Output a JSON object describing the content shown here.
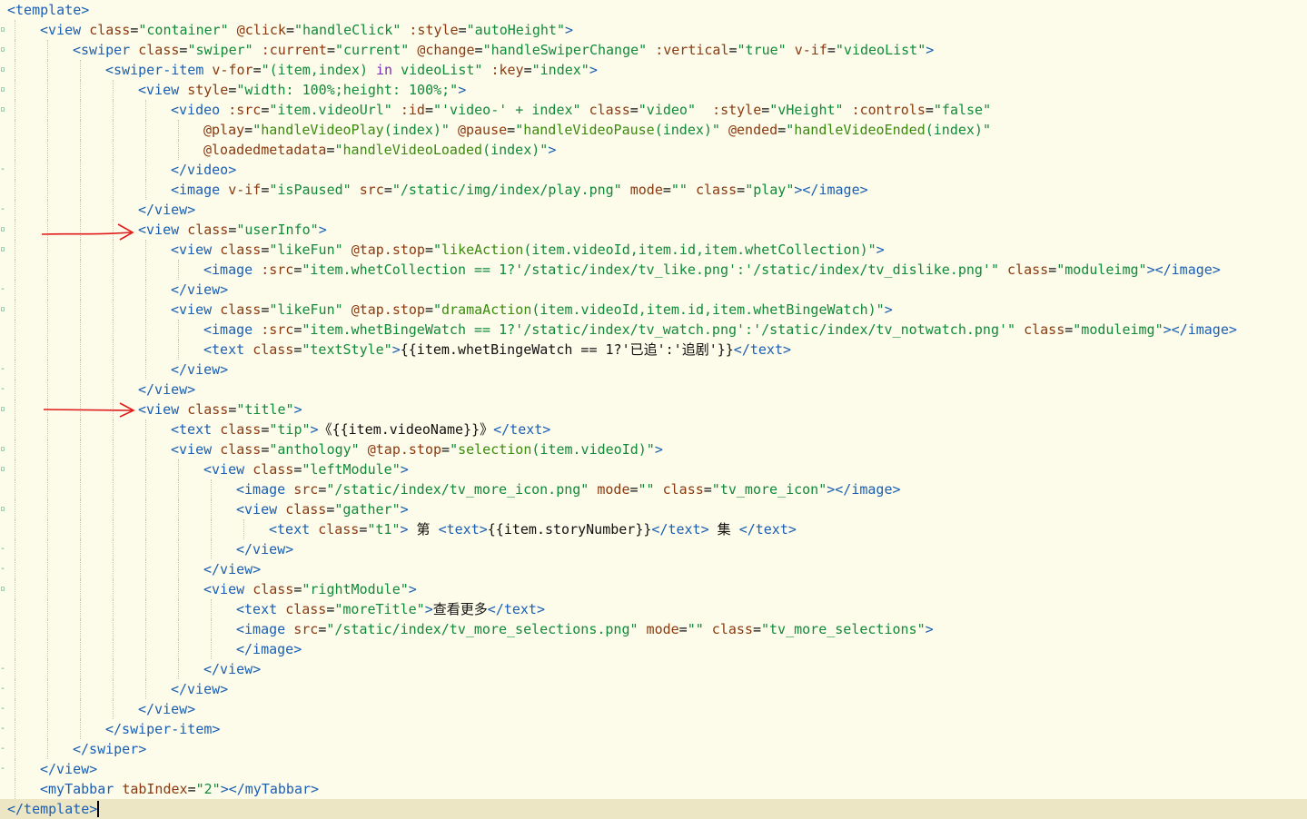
{
  "colors": {
    "background": "#fdfbe9",
    "current_line": "#ece6c4",
    "tag": "#1a5fb4",
    "attribute": "#8a3a10",
    "string": "#118a3a",
    "function": "#3b8a10",
    "keyword": "#7a2fb0",
    "annotation_arrow": "#e01b1b"
  },
  "annotations": [
    "red-arrow-userinfo",
    "red-arrow-title"
  ],
  "lines": [
    {
      "indent": 0,
      "fold": "",
      "current": false,
      "tokens": [
        [
          "tag",
          "<template>"
        ]
      ]
    },
    {
      "indent": 1,
      "fold": "▫",
      "current": false,
      "tokens": [
        [
          "tag",
          "<view "
        ],
        [
          "attr",
          "class"
        ],
        [
          "txt",
          "="
        ],
        [
          "str",
          "\"container\""
        ],
        [
          "txt",
          " "
        ],
        [
          "attr",
          "@click"
        ],
        [
          "txt",
          "="
        ],
        [
          "str",
          "\"handleClick\""
        ],
        [
          "txt",
          " "
        ],
        [
          "attr",
          ":style"
        ],
        [
          "txt",
          "="
        ],
        [
          "str",
          "\"autoHeight\""
        ],
        [
          "tag",
          ">"
        ]
      ]
    },
    {
      "indent": 2,
      "fold": "▫",
      "current": false,
      "tokens": [
        [
          "tag",
          "<swiper "
        ],
        [
          "attr",
          "class"
        ],
        [
          "txt",
          "="
        ],
        [
          "str",
          "\"swiper\""
        ],
        [
          "txt",
          " "
        ],
        [
          "attr",
          ":current"
        ],
        [
          "txt",
          "="
        ],
        [
          "str",
          "\"current\""
        ],
        [
          "txt",
          " "
        ],
        [
          "attr",
          "@change"
        ],
        [
          "txt",
          "="
        ],
        [
          "str",
          "\"handleSwiperChange\""
        ],
        [
          "txt",
          " "
        ],
        [
          "attr",
          ":vertical"
        ],
        [
          "txt",
          "="
        ],
        [
          "str",
          "\"true\""
        ],
        [
          "txt",
          " "
        ],
        [
          "attr",
          "v-if"
        ],
        [
          "txt",
          "="
        ],
        [
          "str",
          "\"videoList\""
        ],
        [
          "tag",
          ">"
        ]
      ]
    },
    {
      "indent": 3,
      "fold": "▫",
      "current": false,
      "tokens": [
        [
          "tag",
          "<swiper-item "
        ],
        [
          "attr",
          "v-for"
        ],
        [
          "txt",
          "="
        ],
        [
          "str",
          "\"(item,index) "
        ],
        [
          "kw",
          "in"
        ],
        [
          "str",
          " videoList\""
        ],
        [
          "txt",
          " "
        ],
        [
          "attr",
          ":key"
        ],
        [
          "txt",
          "="
        ],
        [
          "str",
          "\"index\""
        ],
        [
          "tag",
          ">"
        ]
      ]
    },
    {
      "indent": 4,
      "fold": "▫",
      "current": false,
      "tokens": [
        [
          "tag",
          "<view "
        ],
        [
          "attr",
          "style"
        ],
        [
          "txt",
          "="
        ],
        [
          "str",
          "\"width: 100%;height: 100%;\""
        ],
        [
          "tag",
          ">"
        ]
      ]
    },
    {
      "indent": 5,
      "fold": "▫",
      "current": false,
      "tokens": [
        [
          "tag",
          "<video "
        ],
        [
          "attr",
          ":src"
        ],
        [
          "txt",
          "="
        ],
        [
          "str",
          "\"item.videoUrl\""
        ],
        [
          "txt",
          " "
        ],
        [
          "attr",
          ":id"
        ],
        [
          "txt",
          "="
        ],
        [
          "str",
          "\"'video-' + index\""
        ],
        [
          "txt",
          " "
        ],
        [
          "attr",
          "class"
        ],
        [
          "txt",
          "="
        ],
        [
          "str",
          "\"video\""
        ],
        [
          "txt",
          "  "
        ],
        [
          "attr",
          ":style"
        ],
        [
          "txt",
          "="
        ],
        [
          "str",
          "\"vHeight\""
        ],
        [
          "txt",
          " "
        ],
        [
          "attr",
          ":controls"
        ],
        [
          "txt",
          "="
        ],
        [
          "str",
          "\"false\""
        ]
      ]
    },
    {
      "indent": 6,
      "fold": "",
      "current": false,
      "tokens": [
        [
          "attr",
          "@play"
        ],
        [
          "txt",
          "="
        ],
        [
          "str",
          "\""
        ],
        [
          "fn",
          "handleVideoPlay"
        ],
        [
          "str",
          "(index)\""
        ],
        [
          "txt",
          " "
        ],
        [
          "attr",
          "@pause"
        ],
        [
          "txt",
          "="
        ],
        [
          "str",
          "\""
        ],
        [
          "fn",
          "handleVideoPause"
        ],
        [
          "str",
          "(index)\""
        ],
        [
          "txt",
          " "
        ],
        [
          "attr",
          "@ended"
        ],
        [
          "txt",
          "="
        ],
        [
          "str",
          "\""
        ],
        [
          "fn",
          "handleVideoEnded"
        ],
        [
          "str",
          "(index)\""
        ]
      ]
    },
    {
      "indent": 6,
      "fold": "",
      "current": false,
      "tokens": [
        [
          "attr",
          "@loadedmetadata"
        ],
        [
          "txt",
          "="
        ],
        [
          "str",
          "\""
        ],
        [
          "fn",
          "handleVideoLoaded"
        ],
        [
          "str",
          "(index)\""
        ],
        [
          "tag",
          ">"
        ]
      ]
    },
    {
      "indent": 5,
      "fold": "-",
      "current": false,
      "tokens": [
        [
          "tag",
          "</video>"
        ]
      ]
    },
    {
      "indent": 5,
      "fold": "",
      "current": false,
      "tokens": [
        [
          "tag",
          "<image "
        ],
        [
          "attr",
          "v-if"
        ],
        [
          "txt",
          "="
        ],
        [
          "str",
          "\"isPaused\""
        ],
        [
          "txt",
          " "
        ],
        [
          "attr",
          "src"
        ],
        [
          "txt",
          "="
        ],
        [
          "str",
          "\"/static/img/index/play.png\""
        ],
        [
          "txt",
          " "
        ],
        [
          "attr",
          "mode"
        ],
        [
          "txt",
          "="
        ],
        [
          "str",
          "\"\""
        ],
        [
          "txt",
          " "
        ],
        [
          "attr",
          "class"
        ],
        [
          "txt",
          "="
        ],
        [
          "str",
          "\"play\""
        ],
        [
          "tag",
          "></image>"
        ]
      ]
    },
    {
      "indent": 4,
      "fold": "-",
      "current": false,
      "tokens": [
        [
          "tag",
          "</view>"
        ]
      ]
    },
    {
      "indent": 4,
      "fold": "▫",
      "current": false,
      "tokens": [
        [
          "tag",
          "<view "
        ],
        [
          "attr",
          "class"
        ],
        [
          "txt",
          "="
        ],
        [
          "str",
          "\"userInfo\""
        ],
        [
          "tag",
          ">"
        ]
      ]
    },
    {
      "indent": 5,
      "fold": "▫",
      "current": false,
      "tokens": [
        [
          "tag",
          "<view "
        ],
        [
          "attr",
          "class"
        ],
        [
          "txt",
          "="
        ],
        [
          "str",
          "\"likeFun\""
        ],
        [
          "txt",
          " "
        ],
        [
          "attr",
          "@tap.stop"
        ],
        [
          "txt",
          "="
        ],
        [
          "str",
          "\""
        ],
        [
          "fn",
          "likeAction"
        ],
        [
          "str",
          "(item.videoId,item.id,item.whetCollection)\""
        ],
        [
          "tag",
          ">"
        ]
      ]
    },
    {
      "indent": 6,
      "fold": "",
      "current": false,
      "tokens": [
        [
          "tag",
          "<image "
        ],
        [
          "attr",
          ":src"
        ],
        [
          "txt",
          "="
        ],
        [
          "str",
          "\"item.whetCollection == 1?'/static/index/tv_like.png':'/static/index/tv_dislike.png'\""
        ],
        [
          "txt",
          " "
        ],
        [
          "attr",
          "class"
        ],
        [
          "txt",
          "="
        ],
        [
          "str",
          "\"moduleimg\""
        ],
        [
          "tag",
          "></image>"
        ]
      ]
    },
    {
      "indent": 5,
      "fold": "-",
      "current": false,
      "tokens": [
        [
          "tag",
          "</view>"
        ]
      ]
    },
    {
      "indent": 5,
      "fold": "▫",
      "current": false,
      "tokens": [
        [
          "tag",
          "<view "
        ],
        [
          "attr",
          "class"
        ],
        [
          "txt",
          "="
        ],
        [
          "str",
          "\"likeFun\""
        ],
        [
          "txt",
          " "
        ],
        [
          "attr",
          "@tap.stop"
        ],
        [
          "txt",
          "="
        ],
        [
          "str",
          "\""
        ],
        [
          "fn",
          "dramaAction"
        ],
        [
          "str",
          "(item.videoId,item.id,item.whetBingeWatch)\""
        ],
        [
          "tag",
          ">"
        ]
      ]
    },
    {
      "indent": 6,
      "fold": "",
      "current": false,
      "tokens": [
        [
          "tag",
          "<image "
        ],
        [
          "attr",
          ":src"
        ],
        [
          "txt",
          "="
        ],
        [
          "str",
          "\"item.whetBingeWatch == 1?'/static/index/tv_watch.png':'/static/index/tv_notwatch.png'\""
        ],
        [
          "txt",
          " "
        ],
        [
          "attr",
          "class"
        ],
        [
          "txt",
          "="
        ],
        [
          "str",
          "\"moduleimg\""
        ],
        [
          "tag",
          "></image>"
        ]
      ]
    },
    {
      "indent": 6,
      "fold": "",
      "current": false,
      "tokens": [
        [
          "tag",
          "<text "
        ],
        [
          "attr",
          "class"
        ],
        [
          "txt",
          "="
        ],
        [
          "str",
          "\"textStyle\""
        ],
        [
          "tag",
          ">"
        ],
        [
          "txt",
          "{{item.whetBingeWatch == 1?'已追':'追剧'}}"
        ],
        [
          "tag",
          "</text>"
        ]
      ]
    },
    {
      "indent": 5,
      "fold": "-",
      "current": false,
      "tokens": [
        [
          "tag",
          "</view>"
        ]
      ]
    },
    {
      "indent": 4,
      "fold": "-",
      "current": false,
      "tokens": [
        [
          "tag",
          "</view>"
        ]
      ]
    },
    {
      "indent": 4,
      "fold": "▫",
      "current": false,
      "tokens": [
        [
          "tag",
          "<view "
        ],
        [
          "attr",
          "class"
        ],
        [
          "txt",
          "="
        ],
        [
          "str",
          "\"title\""
        ],
        [
          "tag",
          ">"
        ]
      ]
    },
    {
      "indent": 5,
      "fold": "",
      "current": false,
      "tokens": [
        [
          "tag",
          "<text "
        ],
        [
          "attr",
          "class"
        ],
        [
          "txt",
          "="
        ],
        [
          "str",
          "\"tip\""
        ],
        [
          "tag",
          ">"
        ],
        [
          "txt",
          "《{{item.videoName}}》"
        ],
        [
          "tag",
          "</text>"
        ]
      ]
    },
    {
      "indent": 5,
      "fold": "▫",
      "current": false,
      "tokens": [
        [
          "tag",
          "<view "
        ],
        [
          "attr",
          "class"
        ],
        [
          "txt",
          "="
        ],
        [
          "str",
          "\"anthology\""
        ],
        [
          "txt",
          " "
        ],
        [
          "attr",
          "@tap.stop"
        ],
        [
          "txt",
          "="
        ],
        [
          "str",
          "\""
        ],
        [
          "fn",
          "selection"
        ],
        [
          "str",
          "(item.videoId)\""
        ],
        [
          "tag",
          ">"
        ]
      ]
    },
    {
      "indent": 6,
      "fold": "▫",
      "current": false,
      "tokens": [
        [
          "tag",
          "<view "
        ],
        [
          "attr",
          "class"
        ],
        [
          "txt",
          "="
        ],
        [
          "str",
          "\"leftModule\""
        ],
        [
          "tag",
          ">"
        ]
      ]
    },
    {
      "indent": 7,
      "fold": "",
      "current": false,
      "tokens": [
        [
          "tag",
          "<image "
        ],
        [
          "attr",
          "src"
        ],
        [
          "txt",
          "="
        ],
        [
          "str",
          "\"/static/index/tv_more_icon.png\""
        ],
        [
          "txt",
          " "
        ],
        [
          "attr",
          "mode"
        ],
        [
          "txt",
          "="
        ],
        [
          "str",
          "\"\""
        ],
        [
          "txt",
          " "
        ],
        [
          "attr",
          "class"
        ],
        [
          "txt",
          "="
        ],
        [
          "str",
          "\"tv_more_icon\""
        ],
        [
          "tag",
          "></image>"
        ]
      ]
    },
    {
      "indent": 7,
      "fold": "▫",
      "current": false,
      "tokens": [
        [
          "tag",
          "<view "
        ],
        [
          "attr",
          "class"
        ],
        [
          "txt",
          "="
        ],
        [
          "str",
          "\"gather\""
        ],
        [
          "tag",
          ">"
        ]
      ]
    },
    {
      "indent": 8,
      "fold": "",
      "current": false,
      "tokens": [
        [
          "tag",
          "<text "
        ],
        [
          "attr",
          "class"
        ],
        [
          "txt",
          "="
        ],
        [
          "str",
          "\"t1\""
        ],
        [
          "tag",
          ">"
        ],
        [
          "txt",
          " 第 "
        ],
        [
          "tag",
          "<text>"
        ],
        [
          "txt",
          "{{item.storyNumber}}"
        ],
        [
          "tag",
          "</text>"
        ],
        [
          "txt",
          " 集 "
        ],
        [
          "tag",
          "</text>"
        ]
      ]
    },
    {
      "indent": 7,
      "fold": "-",
      "current": false,
      "tokens": [
        [
          "tag",
          "</view>"
        ]
      ]
    },
    {
      "indent": 6,
      "fold": "-",
      "current": false,
      "tokens": [
        [
          "tag",
          "</view>"
        ]
      ]
    },
    {
      "indent": 6,
      "fold": "▫",
      "current": false,
      "tokens": [
        [
          "tag",
          "<view "
        ],
        [
          "attr",
          "class"
        ],
        [
          "txt",
          "="
        ],
        [
          "str",
          "\"rightModule\""
        ],
        [
          "tag",
          ">"
        ]
      ]
    },
    {
      "indent": 7,
      "fold": "",
      "current": false,
      "tokens": [
        [
          "tag",
          "<text "
        ],
        [
          "attr",
          "class"
        ],
        [
          "txt",
          "="
        ],
        [
          "str",
          "\"moreTitle\""
        ],
        [
          "tag",
          ">"
        ],
        [
          "txt",
          "查看更多"
        ],
        [
          "tag",
          "</text>"
        ]
      ]
    },
    {
      "indent": 7,
      "fold": "",
      "current": false,
      "tokens": [
        [
          "tag",
          "<image "
        ],
        [
          "attr",
          "src"
        ],
        [
          "txt",
          "="
        ],
        [
          "str",
          "\"/static/index/tv_more_selections.png\""
        ],
        [
          "txt",
          " "
        ],
        [
          "attr",
          "mode"
        ],
        [
          "txt",
          "="
        ],
        [
          "str",
          "\"\""
        ],
        [
          "txt",
          " "
        ],
        [
          "attr",
          "class"
        ],
        [
          "txt",
          "="
        ],
        [
          "str",
          "\"tv_more_selections\""
        ],
        [
          "tag",
          ">"
        ]
      ]
    },
    {
      "indent": 7,
      "fold": "",
      "current": false,
      "tokens": [
        [
          "tag",
          "</image>"
        ]
      ]
    },
    {
      "indent": 6,
      "fold": "-",
      "current": false,
      "tokens": [
        [
          "tag",
          "</view>"
        ]
      ]
    },
    {
      "indent": 5,
      "fold": "-",
      "current": false,
      "tokens": [
        [
          "tag",
          "</view>"
        ]
      ]
    },
    {
      "indent": 4,
      "fold": "-",
      "current": false,
      "tokens": [
        [
          "tag",
          "</view>"
        ]
      ]
    },
    {
      "indent": 3,
      "fold": "-",
      "current": false,
      "tokens": [
        [
          "tag",
          "</swiper-item>"
        ]
      ]
    },
    {
      "indent": 2,
      "fold": "-",
      "current": false,
      "tokens": [
        [
          "tag",
          "</swiper>"
        ]
      ]
    },
    {
      "indent": 1,
      "fold": "-",
      "current": false,
      "tokens": [
        [
          "tag",
          "</view>"
        ]
      ]
    },
    {
      "indent": 1,
      "fold": "",
      "current": false,
      "tokens": [
        [
          "tag",
          "<myTabbar "
        ],
        [
          "attr",
          "tabIndex"
        ],
        [
          "txt",
          "="
        ],
        [
          "str",
          "\"2\""
        ],
        [
          "tag",
          "></myTabbar>"
        ]
      ]
    },
    {
      "indent": 0,
      "fold": "",
      "current": true,
      "tokens": [
        [
          "tag",
          "</template>"
        ]
      ]
    }
  ]
}
